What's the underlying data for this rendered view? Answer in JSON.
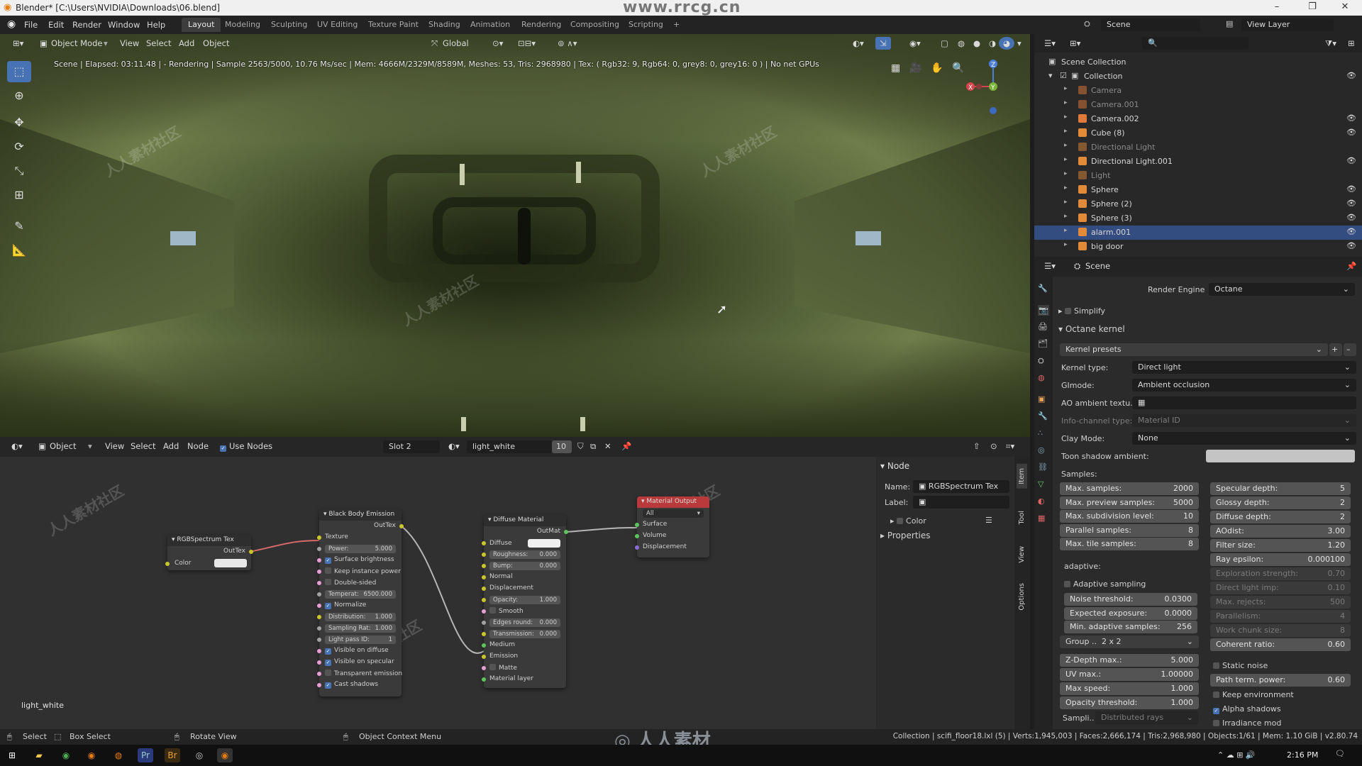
{
  "window": {
    "title": "Blender* [C:\\Users\\NVIDIA\\Downloads\\06.blend]",
    "watermark_top": "www.rrcg.cn",
    "watermark_bottom": "人人素材",
    "watermark_tile": "人人素材社区"
  },
  "menu": [
    "File",
    "Edit",
    "Render",
    "Window",
    "Help"
  ],
  "workspaces": [
    "Layout",
    "Modeling",
    "Sculpting",
    "UV Editing",
    "Texture Paint",
    "Shading",
    "Animation",
    "Rendering",
    "Compositing",
    "Scripting"
  ],
  "workspace_add": "+",
  "scene_field": "Scene",
  "viewlayer_field": "View Layer",
  "viewport": {
    "mode": "Object Mode",
    "menus": [
      "View",
      "Select",
      "Add",
      "Object"
    ],
    "orientation": "Global",
    "status": "Scene | Elapsed: 03:11.48 | - Rendering | Sample 2563/5000, 10.76 Ms/sec | Mem: 4666M/2329M/8589M, Meshes: 53, Tris: 2968980 | Tex: ( Rgb32: 9, Rgb64: 0, grey8: 0, grey16: 0 ) | No net GPUs",
    "active_label": "light_white",
    "gizmo": {
      "x": "X",
      "y": "Y",
      "z": "Z"
    }
  },
  "node_editor": {
    "type": "Object",
    "menus": [
      "View",
      "Select",
      "Add",
      "Node"
    ],
    "use_nodes": "Use Nodes",
    "slot": "Slot 2",
    "material": "light_white",
    "users": "10",
    "nodes": {
      "rgb": {
        "title": "RGBSpectrum Tex",
        "out": "OutTex",
        "color": "Color"
      },
      "bb": {
        "title": "Black Body Emission",
        "out": "OutTex",
        "texture": "Texture",
        "power_l": "Power:",
        "power_v": "5.000",
        "surface": "Surface brightness",
        "keep": "Keep instance power",
        "double": "Double-sided",
        "temp_l": "Temperat:",
        "temp_v": "6500.000",
        "normalize": "Normalize",
        "dist_l": "Distribution:",
        "dist_v": "1.000",
        "samp_l": "Sampling Rat:",
        "samp_v": "1.000",
        "lp_l": "Light pass ID:",
        "lp_v": "1",
        "vis_diff": "Visible on diffuse",
        "vis_spec": "Visible on specular",
        "trans_em": "Transparent emission",
        "cast": "Cast shadows"
      },
      "diff": {
        "title": "Diffuse Material",
        "out": "OutMat",
        "diffuse": "Diffuse",
        "rough_l": "Roughness:",
        "rough_v": "0.000",
        "bump_l": "Bump:",
        "bump_v": "0.000",
        "normal": "Normal",
        "disp": "Displacement",
        "op_l": "Opacity:",
        "op_v": "1.000",
        "smooth": "Smooth",
        "edge_l": "Edges round:",
        "edge_v": "0.000",
        "trans_l": "Transmission:",
        "trans_v": "0.000",
        "medium": "Medium",
        "emission": "Emission",
        "matte": "Matte",
        "layer": "Material layer"
      },
      "out": {
        "title": "Material Output",
        "target": "All",
        "surface": "Surface",
        "volume": "Volume",
        "disp": "Displacement"
      }
    },
    "sidebar": {
      "section": "Node",
      "name_l": "Name:",
      "name_v": "RGBSpectrum Tex",
      "label_l": "Label:",
      "color": "Color",
      "properties": "Properties"
    },
    "vtabs": [
      "Item",
      "Tool",
      "View",
      "Options"
    ]
  },
  "outliner": {
    "root": "Scene Collection",
    "collection": "Collection",
    "items": [
      {
        "name": "Camera",
        "dim": true,
        "color": "#e07a3a"
      },
      {
        "name": "Camera.001",
        "dim": true,
        "color": "#e07a3a"
      },
      {
        "name": "Camera.002",
        "dim": false,
        "color": "#e07a3a"
      },
      {
        "name": "Cube (8)",
        "dim": false,
        "color": "#e08a3a"
      },
      {
        "name": "Directional Light",
        "dim": true,
        "color": "#e08a3a"
      },
      {
        "name": "Directional Light.001",
        "dim": false,
        "color": "#e08a3a"
      },
      {
        "name": "Light",
        "dim": true,
        "color": "#e08a3a"
      },
      {
        "name": "Sphere",
        "dim": false,
        "color": "#e08a3a"
      },
      {
        "name": "Sphere (2)",
        "dim": false,
        "color": "#e08a3a"
      },
      {
        "name": "Sphere (3)",
        "dim": false,
        "color": "#e08a3a"
      },
      {
        "name": "alarm.001",
        "dim": false,
        "color": "#e08a3a",
        "selected": true
      },
      {
        "name": "big door",
        "dim": false,
        "color": "#e08a3a"
      }
    ]
  },
  "properties": {
    "scene": "Scene",
    "render_engine_l": "Render Engine",
    "render_engine_v": "Octane",
    "simplify": "Simplify",
    "kernel": "Octane kernel",
    "kernel_presets": "Kernel presets",
    "kernel_type_l": "Kernel type:",
    "kernel_type_v": "Direct light",
    "gimode_l": "GImode:",
    "gimode_v": "Ambient occlusion",
    "ao_l": "AO ambient textu..",
    "info_l": "Info-channel type:",
    "info_v": "Material ID",
    "clay_l": "Clay Mode:",
    "clay_v": "None",
    "toon_l": "Toon shadow ambient:",
    "samples": "Samples:",
    "left_fields": [
      {
        "l": "Max. samples:",
        "v": "2000"
      },
      {
        "l": "Max. preview samples:",
        "v": "5000"
      },
      {
        "l": "Max. subdivision level:",
        "v": "10"
      },
      {
        "l": "Parallel samples:",
        "v": "8"
      },
      {
        "l": "Max. tile samples:",
        "v": "8"
      }
    ],
    "right_fields": [
      {
        "l": "Specular depth:",
        "v": "5"
      },
      {
        "l": "Glossy depth:",
        "v": "2"
      },
      {
        "l": "Diffuse depth:",
        "v": "2"
      },
      {
        "l": "AOdist:",
        "v": "3.00"
      },
      {
        "l": "Filter size:",
        "v": "1.20"
      },
      {
        "l": "Ray epsilon:",
        "v": "0.000100"
      },
      {
        "l": "Exploration strength:",
        "v": "0.70",
        "d": true
      },
      {
        "l": "Direct light imp:",
        "v": "0.10",
        "d": true
      },
      {
        "l": "Max. rejects:",
        "v": "500",
        "d": true
      },
      {
        "l": "Parallelism:",
        "v": "4",
        "d": true
      },
      {
        "l": "Work chunk size:",
        "v": "8",
        "d": true
      },
      {
        "l": "Coherent ratio:",
        "v": "0.60"
      }
    ],
    "adaptive": "adaptive:",
    "adaptive_sampling": "Adaptive sampling",
    "adaptive_fields": [
      {
        "l": "Noise threshold:",
        "v": "0.0300"
      },
      {
        "l": "Expected exposure:",
        "v": "0.0000"
      },
      {
        "l": "Min. adaptive samples:",
        "v": "256"
      }
    ],
    "group_l": "Group ..",
    "group_v": "2 x 2",
    "lower_fields": [
      {
        "l": "Z-Depth max.:",
        "v": "5.000"
      },
      {
        "l": "UV max.:",
        "v": "1.00000"
      },
      {
        "l": "Max speed:",
        "v": "1.000"
      },
      {
        "l": "Opacity threshold:",
        "v": "1.000"
      }
    ],
    "sampl_l": "Sampli..",
    "sampl_v": "Distributed rays",
    "static_noise": "Static noise",
    "path_term_l": "Path term. power:",
    "path_term_v": "0.60",
    "keep_env": "Keep environment",
    "alpha_sh": "Alpha shadows",
    "irradiance": "Irradiance mod"
  },
  "statusbar": {
    "select": "Select",
    "box": "Box Select",
    "rotate": "Rotate View",
    "ctx": "Object Context Menu",
    "info": "Collection | scifi_floor18.lxl (5) | Verts:1,945,003 | Faces:2,666,174 | Tris:2,968,980 | Objects:1/61 | Mem: 1.10 GiB | v2.80.74"
  },
  "taskbar": {
    "time": "2:16 PM"
  }
}
